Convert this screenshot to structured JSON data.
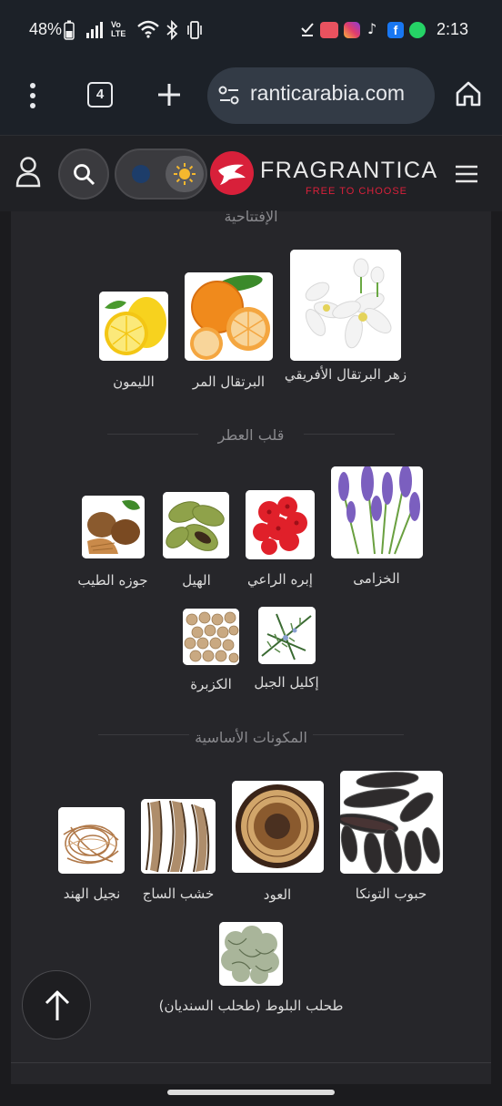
{
  "status": {
    "battery": "48%",
    "volte": "Vo LTE",
    "time": "2:13"
  },
  "browser": {
    "tab_count": "4",
    "url": "ranticarabia.com"
  },
  "site": {
    "brand": "FRAGRANTICA",
    "tagline": "FREE TO CHOOSE"
  },
  "sections": {
    "top": "الإفتتاحية",
    "heart": "قلب العطر",
    "base": "المكونات الأساسية"
  },
  "notes": {
    "top": [
      "زهر البرتقال الأفريقي",
      "البرتقال المر",
      "الليمون"
    ],
    "heart": [
      "الخزامى",
      "إبره الراعي",
      "الهيل",
      "جوزه الطيب",
      "إكليل الجبل",
      "الكزبرة"
    ],
    "base": [
      "حبوب التونكا",
      "العود",
      "خشب الساج",
      "نجيل الهند",
      "طحلب البلوط (طحلب السنديان)"
    ]
  },
  "colors": {
    "brand_red": "#d8203a",
    "background": "#1b1b1e",
    "panel": "#26262a"
  }
}
